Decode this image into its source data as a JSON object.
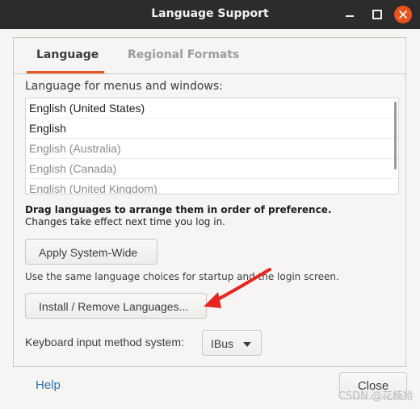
{
  "window": {
    "title": "Language Support"
  },
  "tabs": [
    {
      "label": "Language",
      "active": true
    },
    {
      "label": "Regional Formats",
      "active": false
    }
  ],
  "language_tab": {
    "caption": "Language for menus and windows:",
    "languages": [
      {
        "label": "English (United States)",
        "enabled": true
      },
      {
        "label": "English",
        "enabled": true
      },
      {
        "label": "English (Australia)",
        "enabled": false
      },
      {
        "label": "English (Canada)",
        "enabled": false
      },
      {
        "label": "English (United Kingdom)",
        "enabled": false
      }
    ],
    "drag_hint_bold": "Drag languages to arrange them in order of preference.",
    "drag_hint": "Changes take effect next time you log in.",
    "apply_button": "Apply System-Wide",
    "system_note": "Use the same language choices for startup and the login screen.",
    "install_button": "Install / Remove Languages...",
    "keyboard_label": "Keyboard input method system:",
    "keyboard_value": "IBus"
  },
  "footer": {
    "help_label": "Help",
    "close_label": "Close"
  },
  "watermark": "CSDN @花楠拾",
  "colors": {
    "accent": "#e95420",
    "titlebar": "#2c2c2c",
    "annotation_arrow": "#e8261f",
    "link": "#2c6fb3"
  },
  "icons": [
    "minimize-icon",
    "maximize-icon",
    "close-icon",
    "dropdown-arrow-icon"
  ]
}
